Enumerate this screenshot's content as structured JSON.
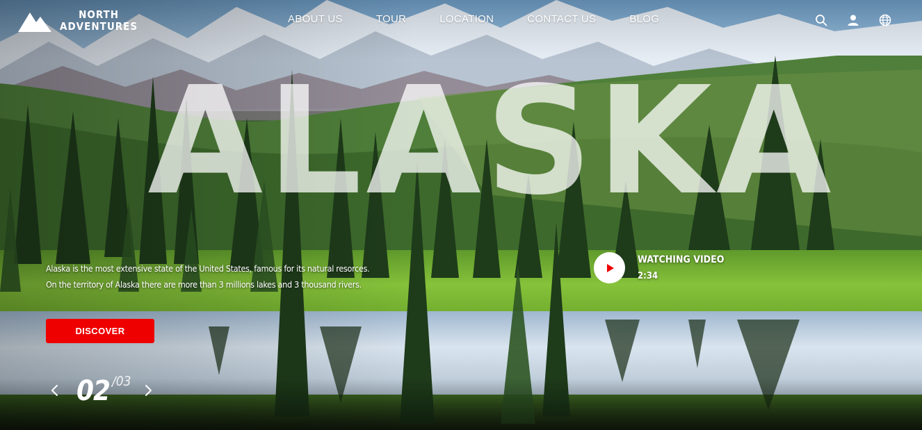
{
  "brand": {
    "line1": "NORTH",
    "line2": "ADVENTURES"
  },
  "nav": {
    "items": [
      "ABOUT US",
      "TOUR",
      "LOCATION",
      "CONTACT US",
      "BLOG"
    ]
  },
  "tools": {
    "icons": [
      "search-icon",
      "user-icon",
      "globe-icon"
    ]
  },
  "hero": {
    "title": "ALASKA",
    "description": "Alaska is the most extensive state of the United States, famous for its natural resorces. On the territory of Alaska there are more than 3 millions lakes and 3 thousand rivers.",
    "cta_label": "DISCOVER"
  },
  "video": {
    "label": "WATCHING VIDEO",
    "duration": "2:34"
  },
  "pager": {
    "current": "02",
    "total": "/03"
  },
  "colors": {
    "accent": "#ef0000",
    "text": "#ffffff"
  }
}
